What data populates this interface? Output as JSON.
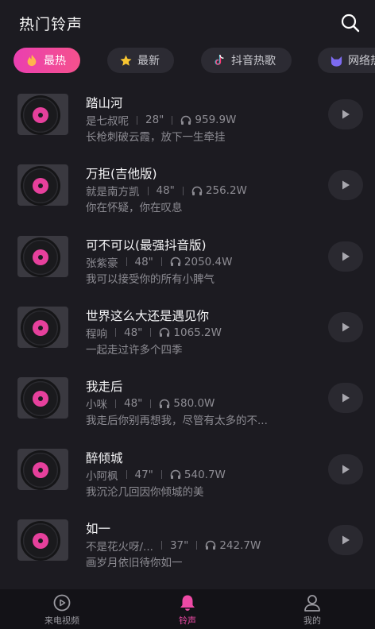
{
  "header": {
    "title": "热门铃声",
    "search_icon": "search-icon"
  },
  "tabs": [
    {
      "label": "最热",
      "icon": "flame-icon",
      "active": true
    },
    {
      "label": "最新",
      "icon": "star-icon",
      "active": false
    },
    {
      "label": "抖音热歌",
      "icon": "tiktok-icon",
      "active": false
    },
    {
      "label": "网络热歌",
      "icon": "cat-icon",
      "active": false
    }
  ],
  "songs": [
    {
      "title": "踏山河",
      "artist": "是七叔呢",
      "duration": "28\"",
      "plays": "959.9W",
      "lyric": "长枪刺破云霞，放下一生牵挂"
    },
    {
      "title": "万拒(吉他版)",
      "artist": "就是南方凯",
      "duration": "48\"",
      "plays": "256.2W",
      "lyric": "你在怀疑，你在叹息"
    },
    {
      "title": "可不可以(最强抖音版)",
      "artist": "张紫豪",
      "duration": "48\"",
      "plays": "2050.4W",
      "lyric": "我可以接受你的所有小脾气"
    },
    {
      "title": "世界这么大还是遇见你",
      "artist": "程响",
      "duration": "48\"",
      "plays": "1065.2W",
      "lyric": "一起走过许多个四季"
    },
    {
      "title": "我走后",
      "artist": "小咪",
      "duration": "48\"",
      "plays": "580.0W",
      "lyric": "我走后你别再想我，尽管有太多的不..."
    },
    {
      "title": "醉倾城",
      "artist": "小阿枫",
      "duration": "47\"",
      "plays": "540.7W",
      "lyric": "我沉沦几回因你倾城的美"
    },
    {
      "title": "如一",
      "artist": "不是花火呀/...",
      "duration": "37\"",
      "plays": "242.7W",
      "lyric": "画岁月依旧待你如一"
    }
  ],
  "bottom_nav": [
    {
      "label": "来电视频",
      "icon": "video-icon",
      "active": false
    },
    {
      "label": "铃声",
      "icon": "bell-icon",
      "active": true
    },
    {
      "label": "我的",
      "icon": "user-icon",
      "active": false
    }
  ],
  "colors": {
    "accent": "#ee4aa6",
    "background": "#1c1b21",
    "disc_label": "#e6409c"
  }
}
